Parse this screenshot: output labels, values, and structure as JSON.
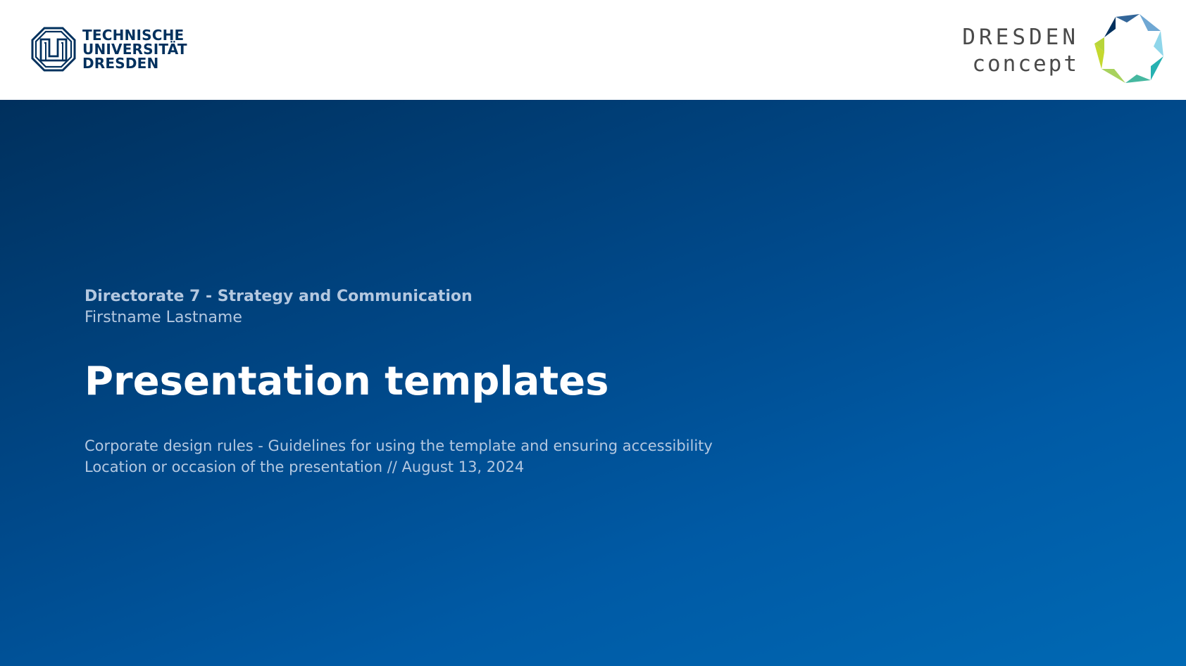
{
  "header": {
    "tu_logo": {
      "lines": [
        "TECHNISCHE",
        "UNIVERSITÄT",
        "DRESDEN"
      ],
      "icon": "tu-dresden-emblem",
      "color": "#00305d"
    },
    "dc_logo": {
      "lines": [
        "DRESDEN",
        "concept"
      ],
      "icon": "dresden-concept-ring",
      "colors": [
        "#00305d",
        "#336699",
        "#6fa7d3",
        "#8fd6ea",
        "#26b1b1",
        "#46b8a0",
        "#a8d25d",
        "#c5d92e"
      ]
    }
  },
  "slide": {
    "organization": "Directorate 7 - Strategy and Communication",
    "author": "Firstname Lastname",
    "title": "Presentation templates",
    "subtitle": "Corporate design rules - Guidelines for using the template and ensuring accessibility",
    "meta": "Location or occasion of the presentation // August 13, 2024"
  },
  "theme": {
    "gradient_start": "#00305d",
    "gradient_end": "#0069b4",
    "text_muted": "#b4c8e0"
  }
}
